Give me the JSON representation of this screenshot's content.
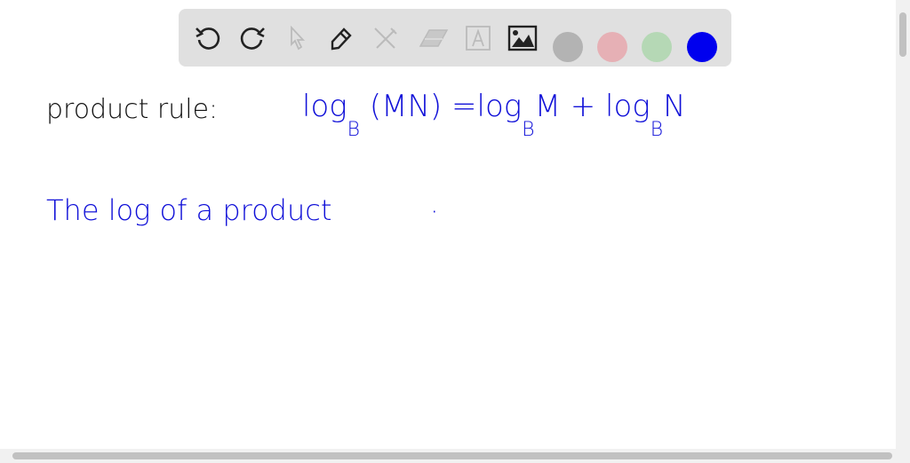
{
  "toolbar": {
    "tools": [
      "undo-icon",
      "redo-icon",
      "select-icon",
      "pen-icon",
      "tools-icon",
      "eraser-icon",
      "text-icon",
      "image-icon"
    ],
    "colors": [
      "#b3b3b3",
      "#e6b0b5",
      "#b5d8b5",
      "#0000ee"
    ]
  },
  "canvas": {
    "label": "product rule:",
    "formula": {
      "log1": "log",
      "base1": "B",
      "arg": "(MN)",
      "eq": "=",
      "log2": "log",
      "base2": "B",
      "m": "M",
      "plus": "+",
      "log3": "log",
      "base3": "B",
      "n": "N"
    },
    "sentence": "The log of a product",
    "dot": "·"
  }
}
